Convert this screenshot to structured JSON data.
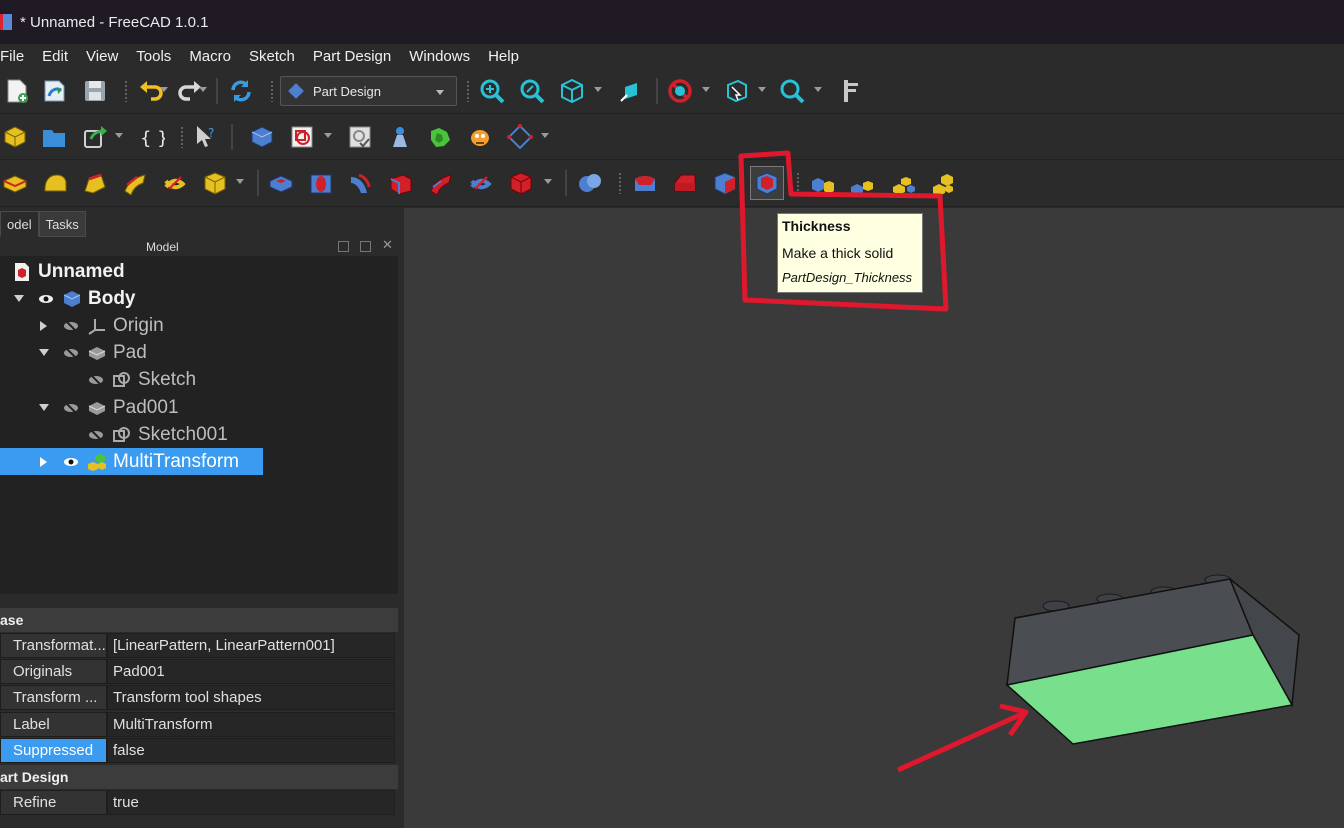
{
  "window": {
    "title": "* Unnamed - FreeCAD 1.0.1"
  },
  "menu": [
    "File",
    "Edit",
    "View",
    "Tools",
    "Macro",
    "Sketch",
    "Part Design",
    "Windows",
    "Help"
  ],
  "workbench_selector": {
    "value": "Part Design"
  },
  "panel": {
    "tabs": [
      "Model",
      "Tasks"
    ],
    "tabs_display": [
      "odel",
      "Tasks"
    ],
    "header": "Model"
  },
  "tree": {
    "document": "Unnamed",
    "body": "Body",
    "origin": "Origin",
    "pad": "Pad",
    "sketch": "Sketch",
    "pad001": "Pad001",
    "sketch001": "Sketch001",
    "multitransform": "MultiTransform"
  },
  "properties": {
    "group_base": "ase",
    "group_partdesign": "art Design",
    "rows": [
      {
        "name": "Transformat...",
        "value": "[LinearPattern, LinearPattern001]"
      },
      {
        "name": "Originals",
        "value": "Pad001"
      },
      {
        "name": "Transform ...",
        "value": "Transform tool shapes"
      },
      {
        "name": "Label",
        "value": "MultiTransform"
      },
      {
        "name": "Suppressed",
        "value": "false"
      }
    ],
    "refine": {
      "name": "Refine",
      "value": "true"
    }
  },
  "tooltip": {
    "title": "Thickness",
    "description": "Make a thick solid",
    "command": "PartDesign_Thickness"
  },
  "colors": {
    "annotation": "#e0182d",
    "selection": "#3a9bf0",
    "face_highlight": "#78e08c",
    "model": "#4a4d52",
    "viewport": "#3a3a3a"
  }
}
